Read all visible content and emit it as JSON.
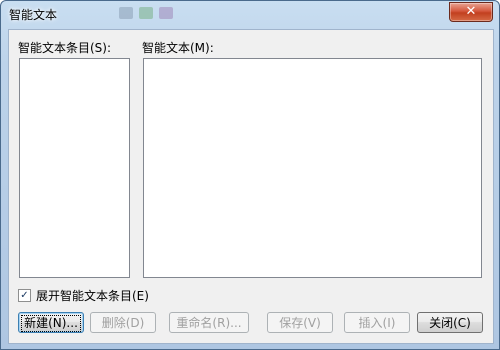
{
  "window": {
    "title": "智能文本",
    "close_symbol": "✕"
  },
  "labels": {
    "entries": "智能文本条目(S):",
    "text": "智能文本(M):",
    "expand_checkbox": "展开智能文本条目(E)"
  },
  "checkbox": {
    "checked_mark": "✓"
  },
  "buttons": {
    "new": "新建(N)...",
    "delete": "删除(D)",
    "rename": "重命名(R)...",
    "save": "保存(V)",
    "insert": "插入(I)",
    "close": "关闭(C)"
  }
}
